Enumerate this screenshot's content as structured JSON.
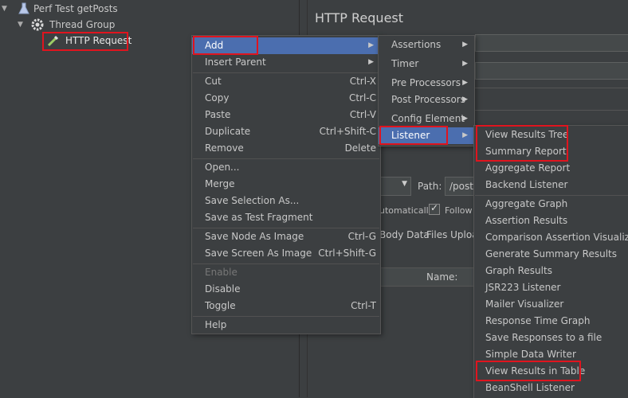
{
  "tree": {
    "items": [
      {
        "label": "Perf Test getPosts",
        "icon": "flask-icon"
      },
      {
        "label": "Thread Group",
        "icon": "gear-icon"
      },
      {
        "label": "HTTP Request",
        "icon": "pipette-icon"
      }
    ]
  },
  "panel": {
    "title": "HTTP Request",
    "path_label": "Path:",
    "path_value": "/posts",
    "follow_redirects_label": "Follow R",
    "automatically_label": "utomatically",
    "tab_body_data": "Body Data",
    "tab_files_upload": "Files Uploa",
    "params_name_header": "Name:"
  },
  "menu": {
    "items": [
      {
        "label": "Add",
        "shortcut": "",
        "submenu": true,
        "selected": true
      },
      {
        "label": "Insert Parent",
        "shortcut": "",
        "submenu": true
      },
      {
        "label": "Cut",
        "shortcut": "Ctrl-X"
      },
      {
        "label": "Copy",
        "shortcut": "Ctrl-C"
      },
      {
        "label": "Paste",
        "shortcut": "Ctrl-V"
      },
      {
        "label": "Duplicate",
        "shortcut": "Ctrl+Shift-C"
      },
      {
        "label": "Remove",
        "shortcut": "Delete"
      },
      {
        "label": "Open...",
        "shortcut": ""
      },
      {
        "label": "Merge",
        "shortcut": ""
      },
      {
        "label": "Save Selection As...",
        "shortcut": ""
      },
      {
        "label": "Save as Test Fragment",
        "shortcut": ""
      },
      {
        "label": "Save Node As Image",
        "shortcut": "Ctrl-G"
      },
      {
        "label": "Save Screen As Image",
        "shortcut": "Ctrl+Shift-G"
      },
      {
        "label": "Enable",
        "shortcut": "",
        "disabled": true
      },
      {
        "label": "Disable",
        "shortcut": ""
      },
      {
        "label": "Toggle",
        "shortcut": "Ctrl-T"
      },
      {
        "label": "Help",
        "shortcut": ""
      }
    ]
  },
  "submenu_add": {
    "items": [
      {
        "label": "Assertions"
      },
      {
        "label": "Timer"
      },
      {
        "label": "Pre Processors"
      },
      {
        "label": "Post Processors"
      },
      {
        "label": "Config Element"
      },
      {
        "label": "Listener",
        "selected": true
      }
    ]
  },
  "submenu_listener": {
    "items": [
      "View Results Tree",
      "Summary Report",
      "Aggregate Report",
      "Backend Listener",
      "Aggregate Graph",
      "Assertion Results",
      "Comparison Assertion Visualizer",
      "Generate Summary Results",
      "Graph Results",
      "JSR223 Listener",
      "Mailer Visualizer",
      "Response Time Graph",
      "Save Responses to a file",
      "Simple Data Writer",
      "View Results in Table",
      "BeanShell Listener"
    ]
  },
  "colors": {
    "selection": "#4b6eaf",
    "highlight_box": "#e0141e",
    "background": "#3c3f41"
  }
}
